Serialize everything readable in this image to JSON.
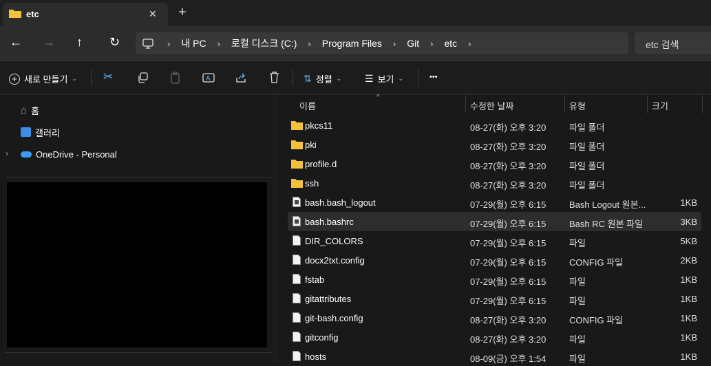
{
  "tab": {
    "title": "etc",
    "close": "✕",
    "new_tab": "+"
  },
  "nav": {
    "breadcrumb": [
      "내 PC",
      "로컬 디스크 (C:)",
      "Program Files",
      "Git",
      "etc"
    ],
    "search_placeholder": "etc 검색"
  },
  "toolbar": {
    "new_label": "새로 만들기",
    "sort_label": "정렬",
    "view_label": "보기",
    "more": "•••"
  },
  "sidebar": {
    "items": [
      {
        "label": "홈",
        "icon": "home-icon"
      },
      {
        "label": "갤러리",
        "icon": "gallery-icon"
      },
      {
        "label": "OneDrive - Personal",
        "icon": "cloud-icon"
      }
    ]
  },
  "list": {
    "headers": {
      "name": "이름",
      "date": "수정한 날짜",
      "type": "유형",
      "size": "크기"
    },
    "rows": [
      {
        "name": "pkcs11",
        "date": "08-27(화) 오후 3:20",
        "type": "파일 폴더",
        "size": "",
        "kind": "folder"
      },
      {
        "name": "pki",
        "date": "08-27(화) 오후 3:20",
        "type": "파일 폴더",
        "size": "",
        "kind": "folder"
      },
      {
        "name": "profile.d",
        "date": "08-27(화) 오후 3:20",
        "type": "파일 폴더",
        "size": "",
        "kind": "folder"
      },
      {
        "name": "ssh",
        "date": "08-27(화) 오후 3:20",
        "type": "파일 폴더",
        "size": "",
        "kind": "folder"
      },
      {
        "name": "bash.bash_logout",
        "date": "07-29(월) 오후 6:15",
        "type": "Bash Logout 원본...",
        "size": "1KB",
        "kind": "script"
      },
      {
        "name": "bash.bashrc",
        "date": "07-29(월) 오후 6:15",
        "type": "Bash RC 원본 파일",
        "size": "3KB",
        "kind": "script",
        "selected": true
      },
      {
        "name": "DIR_COLORS",
        "date": "07-29(월) 오후 6:15",
        "type": "파일",
        "size": "5KB",
        "kind": "file"
      },
      {
        "name": "docx2txt.config",
        "date": "07-29(월) 오후 6:15",
        "type": "CONFIG 파일",
        "size": "2KB",
        "kind": "file"
      },
      {
        "name": "fstab",
        "date": "07-29(월) 오후 6:15",
        "type": "파일",
        "size": "1KB",
        "kind": "file"
      },
      {
        "name": "gitattributes",
        "date": "07-29(월) 오후 6:15",
        "type": "파일",
        "size": "1KB",
        "kind": "file"
      },
      {
        "name": "git-bash.config",
        "date": "08-27(화) 오후 3:20",
        "type": "CONFIG 파일",
        "size": "1KB",
        "kind": "file"
      },
      {
        "name": "gitconfig",
        "date": "08-27(화) 오후 3:20",
        "type": "파일",
        "size": "1KB",
        "kind": "file"
      },
      {
        "name": "hosts",
        "date": "08-09(금) 오후 1:54",
        "type": "파일",
        "size": "1KB",
        "kind": "file"
      }
    ]
  }
}
